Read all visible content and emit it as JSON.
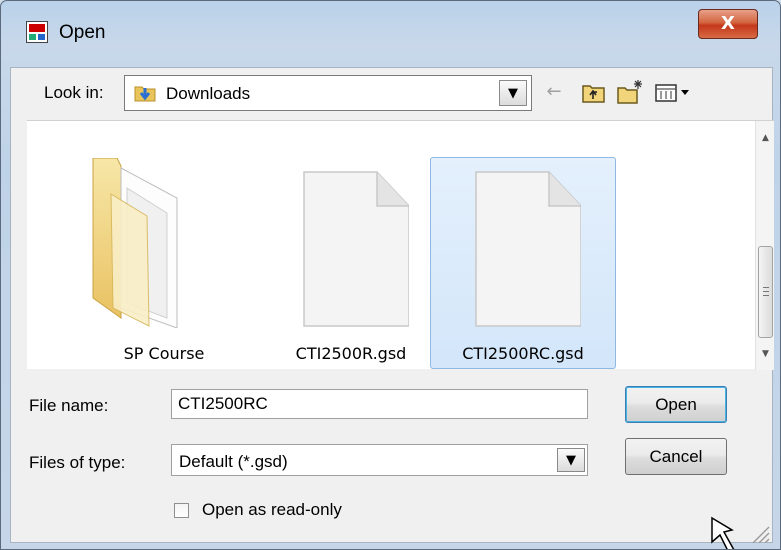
{
  "window": {
    "title": "Open",
    "close_glyph": "X"
  },
  "toolbar": {
    "look_in_label": "Look in:",
    "look_in_value": "Downloads",
    "back_icon": "back-arrow-icon",
    "up_icon": "up-folder-icon",
    "new_folder_icon": "new-folder-icon",
    "views_icon": "views-menu-icon"
  },
  "files": [
    {
      "name": "SP Course",
      "type": "folder",
      "selected": false
    },
    {
      "name": "CTI2500R.gsd",
      "type": "file",
      "selected": false
    },
    {
      "name": "CTI2500RC.gsd",
      "type": "file",
      "selected": true
    }
  ],
  "form": {
    "file_name_label": "File name:",
    "file_name_value": "CTI2500RC",
    "file_type_label": "Files of type:",
    "file_type_value": "Default (*.gsd)",
    "read_only_label": "Open as read-only",
    "read_only_checked": false
  },
  "buttons": {
    "open": "Open",
    "cancel": "Cancel"
  },
  "colors": {
    "selection_fill": "#d3e6fa",
    "selection_border": "#8fb8e4",
    "close_button": "#c4381a",
    "folder_yellow": "#f2d57a"
  }
}
